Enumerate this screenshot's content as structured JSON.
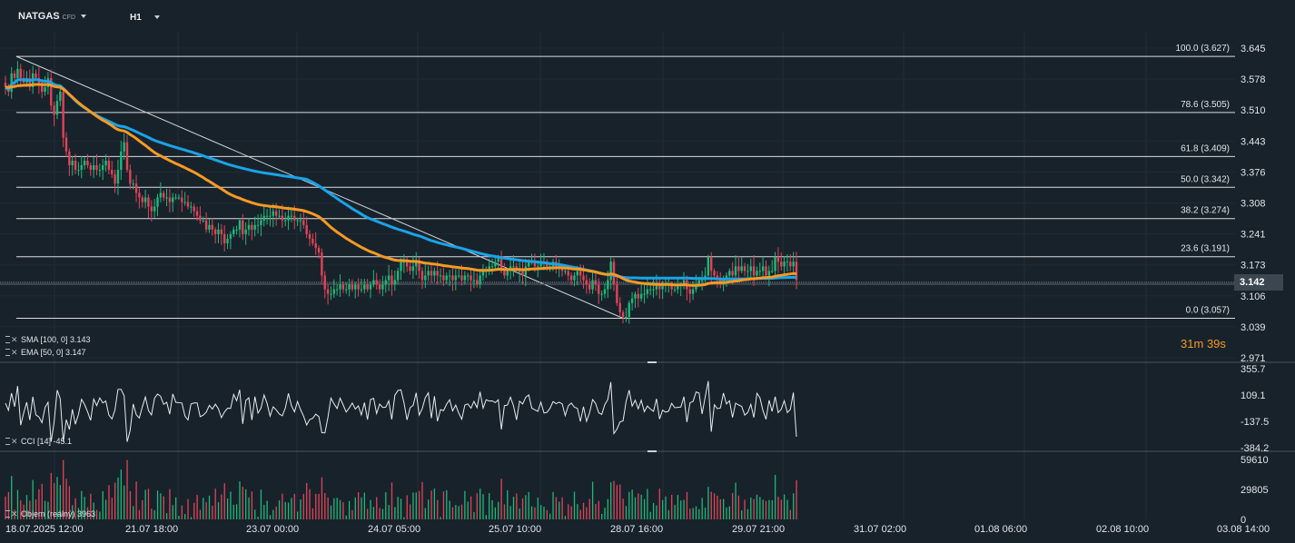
{
  "header": {
    "symbol": "NATGAS",
    "symbol_type": "CFD",
    "timeframe": "H1"
  },
  "price_axis": {
    "labels": [
      "3.645",
      "3.578",
      "3.510",
      "3.443",
      "3.376",
      "3.308",
      "3.241",
      "3.173",
      "3.106",
      "3.039",
      "2.971"
    ],
    "current_price": "3.142"
  },
  "fibonacci": {
    "levels": [
      {
        "label": "100.0 (3.627)",
        "price": 3.627
      },
      {
        "label": "78.6 (3.505)",
        "price": 3.505
      },
      {
        "label": "61.8 (3.409)",
        "price": 3.409
      },
      {
        "label": "50.0 (3.342)",
        "price": 3.342
      },
      {
        "label": "38.2 (3.274)",
        "price": 3.274
      },
      {
        "label": "23.6 (3.191)",
        "price": 3.191
      },
      {
        "label": "0.0 (3.057)",
        "price": 3.057
      }
    ]
  },
  "indicators": {
    "sma": "SMA [100,  0] 3.143",
    "ema": "EMA [50,  0] 3.147",
    "cci": "CCI [14]  -45.1",
    "volume": "Objem  (reálný)  3963"
  },
  "cci_axis": [
    "355.7",
    "109.1",
    "-137.5",
    "-384.2"
  ],
  "volume_axis": [
    "59610",
    "29805",
    "0"
  ],
  "countdown": {
    "minutes": "31",
    "m": "m",
    "seconds": "39",
    "s": "s"
  },
  "time_axis": [
    "18.07.2025  12:00",
    "21.07  18:00",
    "23.07  00:00",
    "24.07  05:00",
    "25.07  10:00",
    "28.07  16:00",
    "29.07  21:00",
    "31.07  02:00",
    "01.08  06:00",
    "02.08  10:00",
    "03.08  14:00"
  ],
  "colors": {
    "background": "#18222b",
    "bull": "#1fb87a",
    "bear": "#e04457",
    "sma": "#1aa3e8",
    "ema": "#f49a25",
    "fib": "#d9dde0"
  },
  "chart_data": {
    "type": "candlestick",
    "ylim": [
      2.971,
      3.645
    ],
    "last_close": 3.142,
    "sma_last": 3.143,
    "ema_last": 3.147,
    "closes": [
      3.56,
      3.55,
      3.59,
      3.58,
      3.6,
      3.58,
      3.57,
      3.58,
      3.56,
      3.59,
      3.58,
      3.57,
      3.55,
      3.56,
      3.58,
      3.52,
      3.5,
      3.53,
      3.55,
      3.45,
      3.42,
      3.39,
      3.4,
      3.38,
      3.38,
      3.39,
      3.4,
      3.39,
      3.38,
      3.39,
      3.38,
      3.38,
      3.39,
      3.4,
      3.38,
      3.37,
      3.35,
      3.38,
      3.42,
      3.44,
      3.38,
      3.35,
      3.35,
      3.33,
      3.32,
      3.31,
      3.32,
      3.3,
      3.29,
      3.3,
      3.32,
      3.33,
      3.32,
      3.32,
      3.31,
      3.32,
      3.32,
      3.32,
      3.31,
      3.31,
      3.3,
      3.3,
      3.29,
      3.28,
      3.27,
      3.27,
      3.25,
      3.26,
      3.25,
      3.24,
      3.25,
      3.24,
      3.22,
      3.23,
      3.24,
      3.25,
      3.25,
      3.27,
      3.24,
      3.25,
      3.26,
      3.25,
      3.26,
      3.26,
      3.27,
      3.28,
      3.28,
      3.28,
      3.29,
      3.28,
      3.28,
      3.27,
      3.27,
      3.28,
      3.28,
      3.27,
      3.27,
      3.27,
      3.26,
      3.24,
      3.23,
      3.22,
      3.21,
      3.2,
      3.15,
      3.12,
      3.11,
      3.11,
      3.12,
      3.12,
      3.13,
      3.12,
      3.12,
      3.13,
      3.12,
      3.13,
      3.12,
      3.12,
      3.13,
      3.12,
      3.13,
      3.14,
      3.13,
      3.12,
      3.13,
      3.14,
      3.15,
      3.13,
      3.14,
      3.16,
      3.18,
      3.18,
      3.17,
      3.16,
      3.17,
      3.18,
      3.16,
      3.14,
      3.15,
      3.16,
      3.15,
      3.16,
      3.15,
      3.15,
      3.14,
      3.15,
      3.15,
      3.14,
      3.15,
      3.15,
      3.14,
      3.15,
      3.15,
      3.14,
      3.14,
      3.13,
      3.15,
      3.16,
      3.16,
      3.17,
      3.17,
      3.18,
      3.19,
      3.16,
      3.15,
      3.16,
      3.17,
      3.17,
      3.16,
      3.16,
      3.15,
      3.17,
      3.18,
      3.18,
      3.17,
      3.17,
      3.18,
      3.18,
      3.17,
      3.17,
      3.18,
      3.17,
      3.17,
      3.16,
      3.16,
      3.15,
      3.14,
      3.15,
      3.16,
      3.15,
      3.14,
      3.13,
      3.12,
      3.14,
      3.13,
      3.11,
      3.11,
      3.12,
      3.14,
      3.18,
      3.13,
      3.09,
      3.07,
      3.06,
      3.06,
      3.09,
      3.1,
      3.11,
      3.1,
      3.11,
      3.11,
      3.12,
      3.12,
      3.12,
      3.13,
      3.12,
      3.13,
      3.13,
      3.13,
      3.12,
      3.12,
      3.13,
      3.13,
      3.14,
      3.12,
      3.11,
      3.12,
      3.13,
      3.14,
      3.14,
      3.15,
      3.19,
      3.16,
      3.15,
      3.14,
      3.13,
      3.14,
      3.15,
      3.16,
      3.15,
      3.17,
      3.16,
      3.17,
      3.16,
      3.16,
      3.17,
      3.15,
      3.16,
      3.16,
      3.17,
      3.15,
      3.16,
      3.16,
      3.19,
      3.18,
      3.17,
      3.18,
      3.18,
      3.17,
      3.18,
      3.14
    ]
  }
}
